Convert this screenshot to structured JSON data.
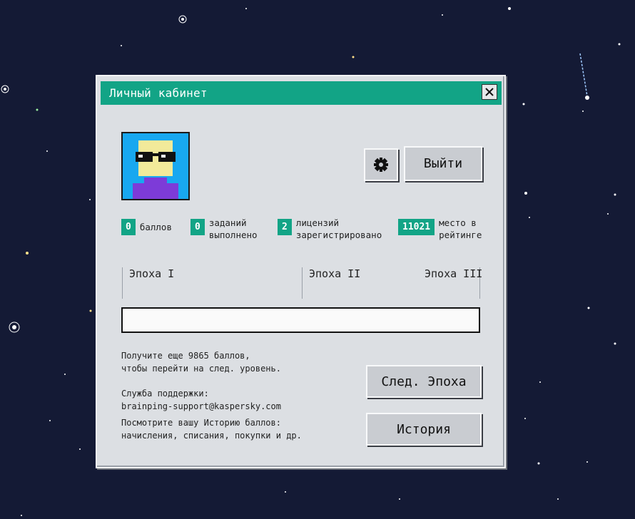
{
  "window": {
    "title": "Личный кабинет",
    "close_icon": "close-icon"
  },
  "profile": {
    "avatar_icon": "pixel-avatar-sunglasses-icon",
    "settings_icon": "gear-icon",
    "logout_label": "Выйти"
  },
  "stats": [
    {
      "value": "0",
      "label_line1": "баллов",
      "label_line2": ""
    },
    {
      "value": "0",
      "label_line1": "заданий",
      "label_line2": "выполнено"
    },
    {
      "value": "2",
      "label_line1": "лицензий",
      "label_line2": "зарегистрировано"
    },
    {
      "value": "11021",
      "label_line1": "место в",
      "label_line2": "рейтинге"
    }
  ],
  "epochs": [
    "Эпоха I",
    "Эпоха II",
    "Эпоха III"
  ],
  "progress": {
    "fraction": 0
  },
  "info": {
    "points_line1": "Получите еще 9865 баллов,",
    "points_line2": "чтобы перейти на след. уровень.",
    "support_line1": "Служба поддержки:",
    "support_line2": "brainping-support@kaspersky.com",
    "history_line1": "Посмотрите вашу Историю баллов:",
    "history_line2": "начисления, списания, покупки и др."
  },
  "buttons": {
    "next_epoch": "След. Эпоха",
    "history": "История"
  },
  "colors": {
    "accent": "#12a486",
    "window_bg": "#dcdfe3",
    "space_bg": "#141a35"
  }
}
